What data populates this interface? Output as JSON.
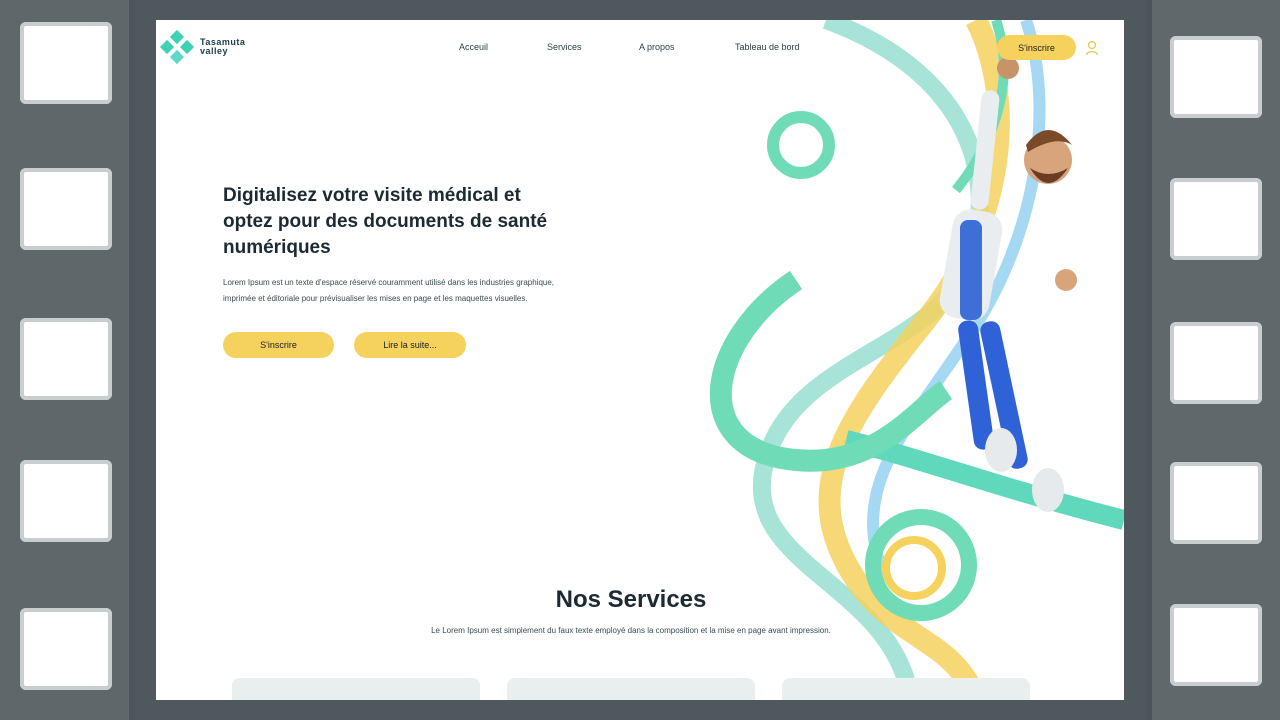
{
  "brand": {
    "line1": "Tasamuta",
    "line2": "valley"
  },
  "nav": {
    "items": [
      "Acceuil",
      "Services",
      "A propos",
      "Tableau de bord"
    ],
    "signup_label": "S'inscrire"
  },
  "hero": {
    "title": "Digitalisez votre visite médical et optez pour des documents de santé numériques",
    "text": "Lorem Ipsum est un texte d'espace réservé couramment utilisé dans les industries graphique, imprimée et éditoriale pour prévisualiser les mises en page et les maquettes visuelles.",
    "primary_button": "S'inscrire",
    "secondary_button": "Lire la suite..."
  },
  "services": {
    "title": "Nos Services",
    "subtitle": "Le Lorem Ipsum est simplement du faux texte employé dans la composition et la mise en page avant impression."
  },
  "colors": {
    "accent": "#f5d25e",
    "teal": "#3fd1b3",
    "blue": "#8fd0f0",
    "dark": "#1c2a33"
  },
  "icons": {
    "user": "user-icon",
    "logo": "logo-icon"
  }
}
